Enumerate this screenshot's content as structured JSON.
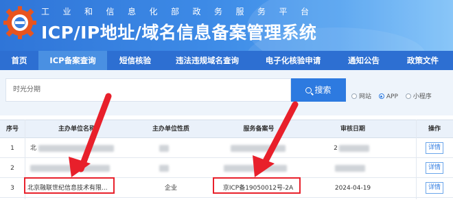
{
  "header": {
    "subtitle": "工业和信息化部政务服务平台",
    "title": "ICP/IP地址/域名信息备案管理系统"
  },
  "nav": {
    "items": [
      {
        "label": "首页",
        "active": false
      },
      {
        "label": "ICP备案查询",
        "active": true
      },
      {
        "label": "短信核验",
        "active": false
      },
      {
        "label": "违法违规域名查询",
        "active": false
      },
      {
        "label": "电子化核验申请",
        "active": false
      },
      {
        "label": "通知公告",
        "active": false
      },
      {
        "label": "政策文件",
        "active": false
      }
    ]
  },
  "search": {
    "value": "时光分期",
    "button_label": "搜索",
    "options": [
      {
        "label": "网站",
        "checked": false
      },
      {
        "label": "APP",
        "checked": true
      },
      {
        "label": "小程序",
        "checked": false
      }
    ]
  },
  "table": {
    "headers": [
      "序号",
      "主办单位名称",
      "主办单位性质",
      "服务备案号",
      "审核日期",
      "操作"
    ],
    "rows": [
      {
        "index": "1",
        "name": "北",
        "nature": "",
        "record": "",
        "date": "2",
        "action": "详情",
        "redacted": true
      },
      {
        "index": "2",
        "name": "",
        "nature": "",
        "record": "",
        "date": "",
        "action": "详情",
        "redacted": true
      },
      {
        "index": "3",
        "name": "北京融联世纪信息技术有限...",
        "nature": "企业",
        "record": "京ICP备19050012号-2A",
        "date": "2024-04-19",
        "action": "详情",
        "redacted": false
      }
    ]
  },
  "colors": {
    "nav_bg": "#2d6fd2",
    "active_tab": "#4a90e2",
    "search_button": "#2d7ae0",
    "highlight": "#e8202b"
  }
}
